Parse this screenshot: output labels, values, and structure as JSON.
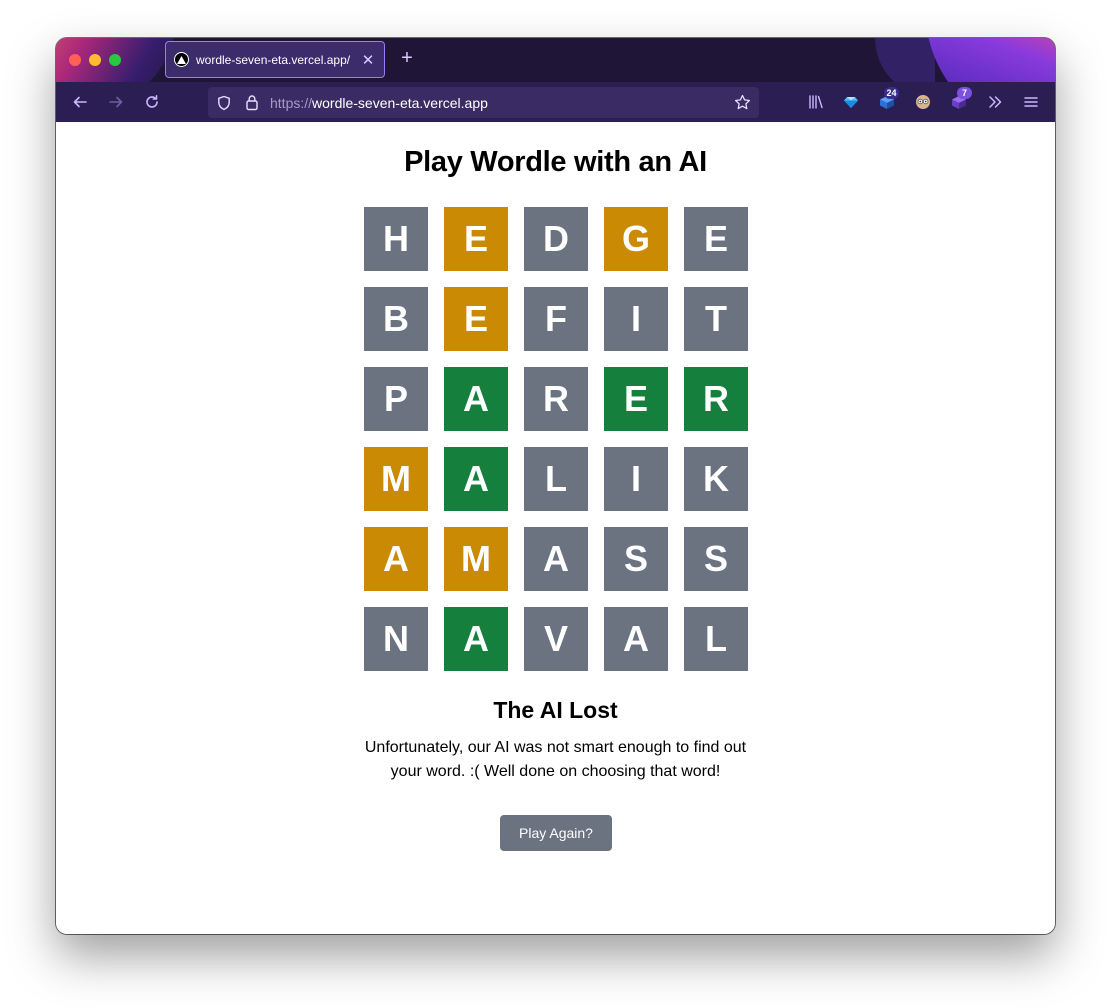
{
  "browser": {
    "tab_title": "wordle-seven-eta.vercel.app/",
    "tab_close_icon": "close-icon",
    "new_tab_icon": "plus-icon",
    "url_scheme": "https://",
    "url_host": "wordle-seven-eta.vercel.app",
    "toolbar_badges": {
      "extension_a_count": "24",
      "extension_b_count": "7"
    },
    "colors": {
      "tabstrip_bg": "#1f1537",
      "toolbar_bg": "#2b1e53",
      "urlbar_bg": "#3a2b64",
      "tab_border": "#9a7cf3"
    }
  },
  "page": {
    "title": "Play Wordle with an AI",
    "board": [
      [
        {
          "letter": "H",
          "state": "absent"
        },
        {
          "letter": "E",
          "state": "present"
        },
        {
          "letter": "D",
          "state": "absent"
        },
        {
          "letter": "G",
          "state": "present"
        },
        {
          "letter": "E",
          "state": "absent"
        }
      ],
      [
        {
          "letter": "B",
          "state": "absent"
        },
        {
          "letter": "E",
          "state": "present"
        },
        {
          "letter": "F",
          "state": "absent"
        },
        {
          "letter": "I",
          "state": "absent"
        },
        {
          "letter": "T",
          "state": "absent"
        }
      ],
      [
        {
          "letter": "P",
          "state": "absent"
        },
        {
          "letter": "A",
          "state": "correct"
        },
        {
          "letter": "R",
          "state": "absent"
        },
        {
          "letter": "E",
          "state": "correct"
        },
        {
          "letter": "R",
          "state": "correct"
        }
      ],
      [
        {
          "letter": "M",
          "state": "present"
        },
        {
          "letter": "A",
          "state": "correct"
        },
        {
          "letter": "L",
          "state": "absent"
        },
        {
          "letter": "I",
          "state": "absent"
        },
        {
          "letter": "K",
          "state": "absent"
        }
      ],
      [
        {
          "letter": "A",
          "state": "present"
        },
        {
          "letter": "M",
          "state": "present"
        },
        {
          "letter": "A",
          "state": "absent"
        },
        {
          "letter": "S",
          "state": "absent"
        },
        {
          "letter": "S",
          "state": "absent"
        }
      ],
      [
        {
          "letter": "N",
          "state": "absent"
        },
        {
          "letter": "A",
          "state": "correct"
        },
        {
          "letter": "V",
          "state": "absent"
        },
        {
          "letter": "A",
          "state": "absent"
        },
        {
          "letter": "L",
          "state": "absent"
        }
      ]
    ],
    "tile_colors": {
      "absent": "#6b7280",
      "present": "#ca8a04",
      "correct": "#15803d"
    },
    "status_title": "The AI Lost",
    "status_message": "Unfortunately, our AI was not smart enough to find out your word. :( Well done on choosing that word!",
    "play_again_label": "Play Again?"
  }
}
